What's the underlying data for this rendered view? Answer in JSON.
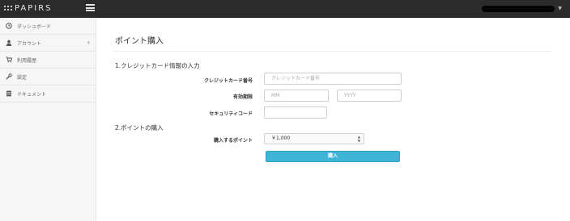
{
  "header": {
    "brand": "PAPIRS",
    "menu_icon": "hamburger-icon",
    "user_caret_icon": "caret-down-icon"
  },
  "sidebar": {
    "items": [
      {
        "label": "ダッシュボード",
        "icon": "dashboard-clock-icon"
      },
      {
        "label": "アカウント",
        "icon": "user-icon",
        "chevron": "‹"
      },
      {
        "label": "利用履歴",
        "icon": "cart-icon"
      },
      {
        "label": "設定",
        "icon": "wrench-icon"
      },
      {
        "label": "ドキュメント",
        "icon": "document-icon"
      }
    ]
  },
  "main": {
    "title": "ポイント購入",
    "section1": {
      "heading": "1.クレジットカード情報の入力",
      "card_number_label": "クレジットカード番号",
      "card_number_placeholder": "クレジットカード番号",
      "expiry_label": "有効期限",
      "month_placeholder": "MM",
      "year_placeholder": "YYYY",
      "security_label": "セキュリティコード",
      "security_value": ""
    },
    "section2": {
      "heading": "2.ポイントの購入",
      "points_label": "購入するポイント",
      "points_selected": "￥1,000"
    },
    "submit_label": "購入",
    "accent_color": "#3fb4d6"
  }
}
